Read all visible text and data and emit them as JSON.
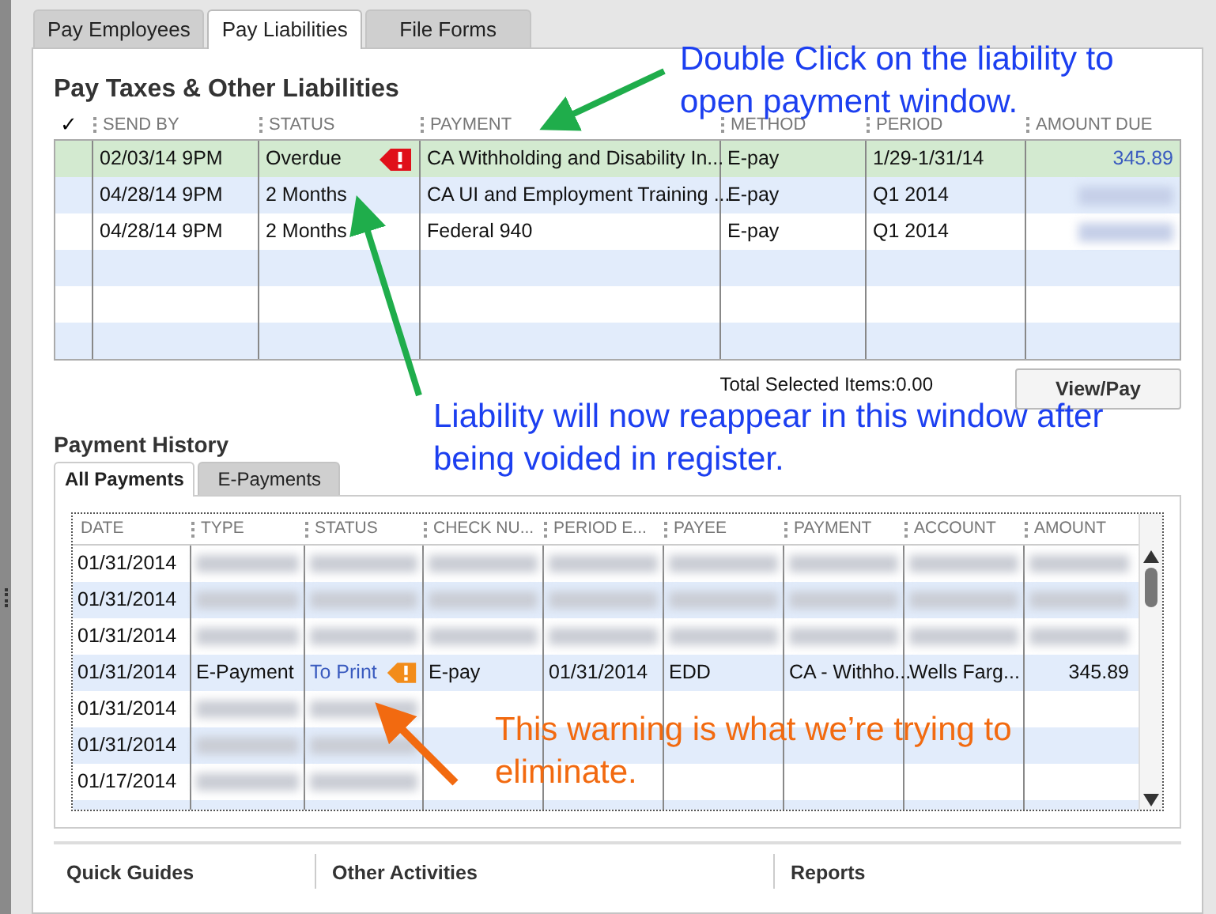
{
  "tabs": [
    {
      "label": "Pay Employees",
      "selected": false
    },
    {
      "label": "Pay Liabilities",
      "selected": true
    },
    {
      "label": "File Forms",
      "selected": false
    }
  ],
  "liabilities": {
    "title": "Pay Taxes & Other Liabilities",
    "check_header": "✓",
    "columns": [
      "SEND BY",
      "STATUS",
      "PAYMENT",
      "METHOD",
      "PERIOD",
      "AMOUNT DUE"
    ],
    "rows": [
      {
        "selected": true,
        "warning": true,
        "cells": [
          "02/03/14 9PM",
          "Overdue",
          "CA Withholding and Disability In...",
          "E-pay",
          "1/29-1/31/14",
          "345.89"
        ]
      },
      {
        "selected": false,
        "warning": false,
        "cells": [
          "04/28/14 9PM",
          "2 Months",
          "CA UI and Employment Training ...",
          "E-pay",
          "Q1 2014"
        ]
      },
      {
        "selected": false,
        "warning": false,
        "cells": [
          "04/28/14 9PM",
          "2 Months",
          "Federal 940",
          "E-pay",
          "Q1 2014"
        ]
      }
    ],
    "total_label": "Total Selected Items:",
    "total_value": "0.00",
    "view_pay_button": "View/Pay"
  },
  "history": {
    "title": "Payment History",
    "tabs": [
      {
        "label": "All Payments",
        "selected": true
      },
      {
        "label": "E-Payments",
        "selected": false
      }
    ],
    "columns": [
      "DATE",
      "TYPE",
      "STATUS",
      "CHECK NU...",
      "PERIOD E...",
      "PAYEE",
      "PAYMENT",
      "ACCOUNT",
      "AMOUNT"
    ],
    "rows": [
      {
        "date": "01/31/2014",
        "blurred": true
      },
      {
        "date": "01/31/2014",
        "blurred": true
      },
      {
        "date": "01/31/2014",
        "blurred": true
      },
      {
        "date": "01/31/2014",
        "blurred": false,
        "warning": true,
        "cells": [
          "E-Payment",
          "To Print",
          "E-pay",
          "01/31/2014",
          "EDD",
          "CA - Withho...",
          "Wells Farg...",
          "345.89"
        ]
      },
      {
        "date": "01/31/2014",
        "blurred": true
      },
      {
        "date": "01/31/2014",
        "blurred": true
      },
      {
        "date": "01/17/2014",
        "blurred": true
      }
    ]
  },
  "footer": [
    "Quick Guides",
    "Other Activities",
    "Reports"
  ],
  "annotations": [
    {
      "kind": "blue",
      "text": "Double Click on the liability to open payment window."
    },
    {
      "kind": "blue",
      "text": "Liability will now reappear in this window after being voided in register."
    },
    {
      "kind": "orange",
      "text": "This warning is what we’re trying to eliminate."
    }
  ]
}
